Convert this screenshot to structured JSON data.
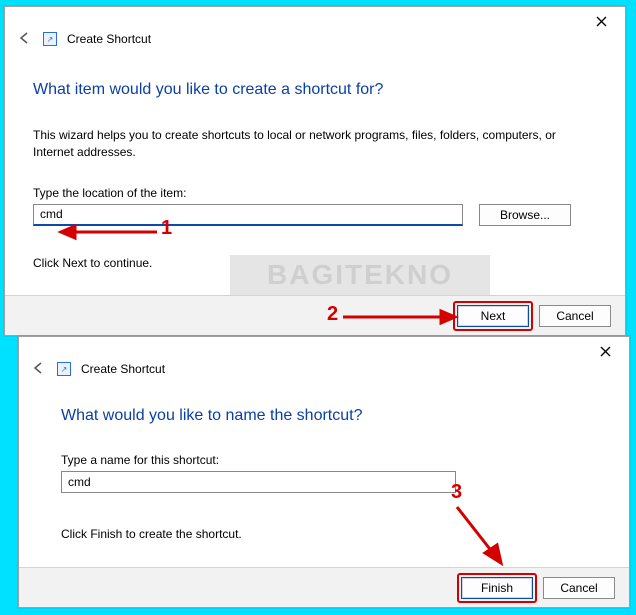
{
  "watermark": "BAGITEKNO",
  "window1": {
    "header_title": "Create Shortcut",
    "heading": "What item would you like to create a shortcut for?",
    "description": "This wizard helps you to create shortcuts to local or network programs, files, folders, computers, or Internet addresses.",
    "field_label": "Type the location of the item:",
    "field_value": "cmd",
    "browse_label": "Browse...",
    "hint": "Click Next to continue.",
    "next_label": "Next",
    "cancel_label": "Cancel"
  },
  "window2": {
    "header_title": "Create Shortcut",
    "heading": "What would you like to name the shortcut?",
    "field_label": "Type a name for this shortcut:",
    "field_value": "cmd",
    "hint": "Click Finish to create the shortcut.",
    "finish_label": "Finish",
    "cancel_label": "Cancel"
  },
  "annotations": {
    "one": "1",
    "two": "2",
    "three": "3"
  }
}
